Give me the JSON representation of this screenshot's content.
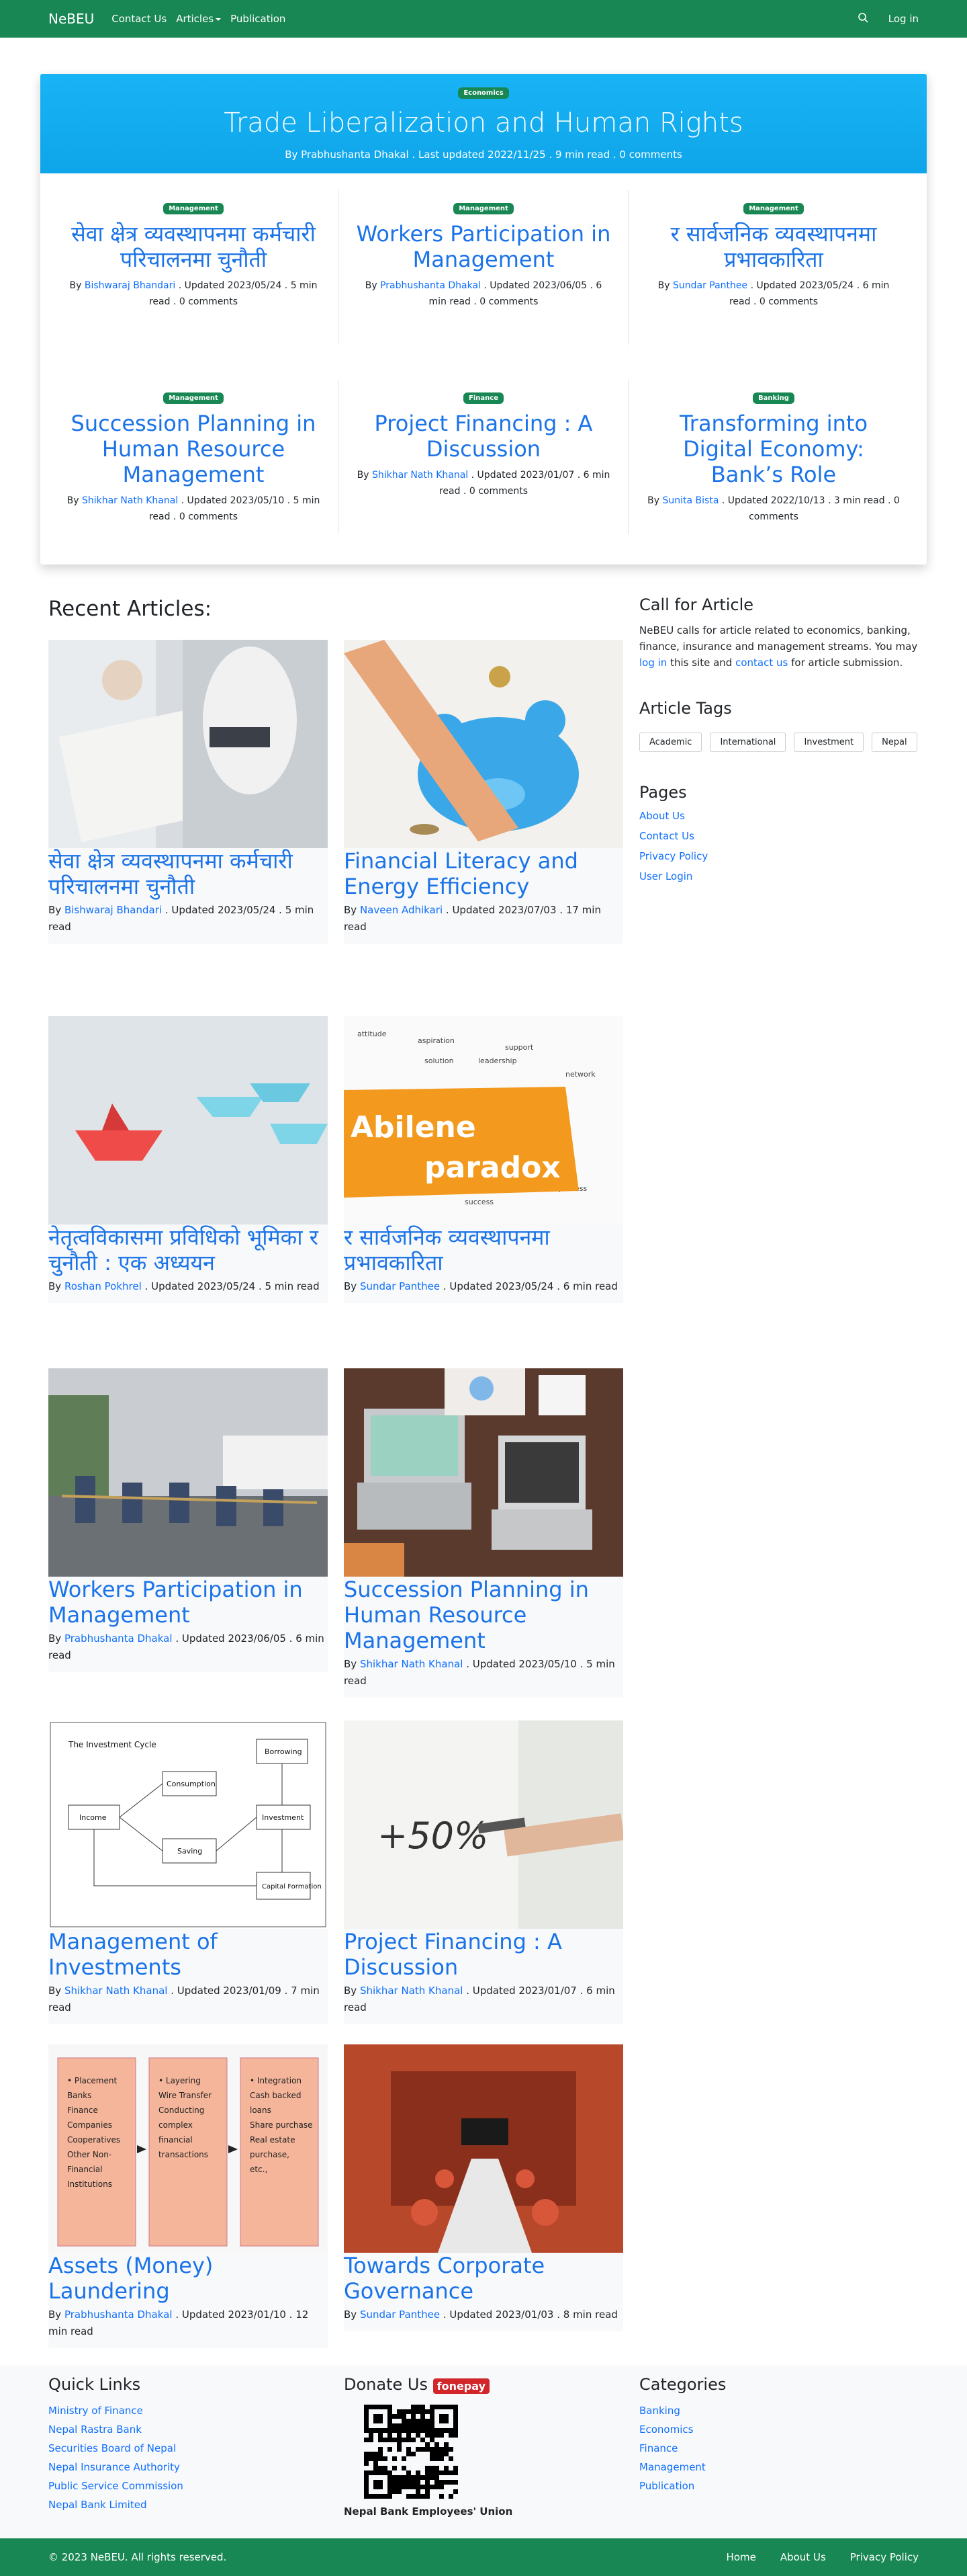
{
  "navbar": {
    "brand": "NeBEU",
    "links": [
      "Contact Us",
      "Articles",
      "Publication"
    ],
    "login": "Log in"
  },
  "hero": {
    "badge": "Economics",
    "title": "Trade Liberalization and Human Rights",
    "meta": "By Prabhushanta Dhakal . Last updated 2022/11/25 . 9 min read . 0 comments"
  },
  "featured": [
    {
      "badge": "Management",
      "title": "सेवा क्षेत्र व्यवस्थापनमा कर्मचारी परिचालनमा चुनौती",
      "author": "Bishwaraj Bhandari",
      "meta": ". Updated 2023/05/24 . 5 min read . 0 comments"
    },
    {
      "badge": "Management",
      "title": "Workers Participation in Management",
      "author": "Prabhushanta Dhakal",
      "meta": ". Updated 2023/06/05 . 6 min read . 0 comments"
    },
    {
      "badge": "Management",
      "title": "र सार्वजनिक व्यवस्थापनमा प्रभावकारिता",
      "author": "Sundar Panthee",
      "meta": ". Updated 2023/05/24 . 6 min read . 0 comments"
    },
    {
      "badge": "Management",
      "title": "Succession Planning in Human Resource Management",
      "author": "Shikhar Nath Khanal",
      "meta": ". Updated 2023/05/10 . 5 min read . 0 comments"
    },
    {
      "badge": "Finance",
      "title": "Project Financing : A Discussion",
      "author": "Shikhar Nath Khanal",
      "meta": ". Updated 2023/01/07 . 6 min read . 0 comments"
    },
    {
      "badge": "Banking",
      "title": "Transforming into Digital Economy: Bank’s Role",
      "author": "Sunita Bista",
      "meta": ". Updated 2022/10/13 . 3 min read . 0 comments"
    }
  ],
  "recent": {
    "heading": "Recent Articles:",
    "by": "By",
    "articles": [
      {
        "title": "सेवा क्षेत्र व्यवस्थापनमा कर्मचारी परिचालनमा चुनौती",
        "author": "Bishwaraj Bhandari",
        "meta": ". Updated 2023/05/24 . 5 min read",
        "img": "paperwork"
      },
      {
        "title": "Financial Literacy and Energy Efficiency",
        "author": "Naveen Adhikari",
        "meta": ". Updated 2023/07/03 . 17 min read",
        "img": "piggy-bank"
      },
      {
        "title": "नेतृत्वविकासमा प्रविधिको भूमिका र चुनौती : एक अध्ययन",
        "author": "Roshan Pokhrel",
        "meta": ". Updated 2023/05/24 . 5 min read",
        "img": "paper-boats"
      },
      {
        "title": "र सार्वजनिक व्यवस्थापनमा प्रभावकारिता",
        "author": "Sundar Panthee",
        "meta": ". Updated 2023/05/24 . 6 min read",
        "img": "abilene-paradox"
      },
      {
        "title": "Workers Participation in Management",
        "author": "Prabhushanta Dhakal",
        "meta": ". Updated 2023/06/05 . 6 min read",
        "img": "tug-of-war"
      },
      {
        "title": "Succession Planning in Human Resource Management",
        "author": "Shikhar Nath Khanal",
        "meta": ". Updated 2023/05/10 . 5 min read",
        "img": "laptops"
      },
      {
        "title": "Management of Investments",
        "author": "Shikhar Nath Khanal",
        "meta": ". Updated 2023/01/09 . 7 min read",
        "img": "investment-cycle"
      },
      {
        "title": "Project Financing : A Discussion",
        "author": "Shikhar Nath Khanal",
        "meta": ". Updated 2023/01/07 . 6 min read",
        "img": "whiteboard"
      },
      {
        "title": "Assets (Money) Laundering",
        "author": "Prabhushanta Dhakal",
        "meta": ". Updated 2023/01/10 . 12 min read",
        "img": "laundering-chart"
      },
      {
        "title": "Towards Corporate Governance",
        "author": "Sundar Panthee",
        "meta": ". Updated 2023/01/03 . 8 min read",
        "img": "meeting-room"
      }
    ]
  },
  "sidebar": {
    "call_title": "Call for Article",
    "call_text_1": "NeBEU calls for article related to economics, banking, finance, insurance and management streams. You may",
    "call_link_1": "log in",
    "call_text_2": "this site and",
    "call_link_2": "contact us",
    "call_text_3": "for article submission.",
    "tags_title": "Article Tags",
    "tags": [
      "Academic",
      "International",
      "Investment",
      "Nepal"
    ],
    "pages_title": "Pages",
    "pages": [
      "About Us",
      "Contact Us",
      "Privacy Policy",
      "User Login"
    ]
  },
  "diagram": {
    "title": "The Investment Cycle",
    "nodes": [
      "Borrowing",
      "Consumption",
      "Income",
      "Investment",
      "Saving",
      "Capital Formation"
    ]
  },
  "laundering": {
    "col1": [
      "Placement",
      "Banks",
      "Finance",
      "Companies",
      "Cooperatives",
      "Other Non-",
      "Financial",
      "Institutions"
    ],
    "col2": [
      "Layering",
      "Wire Transfer",
      "Conducting",
      "complex",
      "financial",
      "transactions"
    ],
    "col3": [
      "Integration",
      "Cash backed",
      "loans",
      "Share purchase",
      "Real estate",
      "purchase,",
      "etc.,"
    ]
  },
  "abilene": {
    "line1": "Abilene",
    "line2": "paradox"
  },
  "whiteboard": {
    "text": "+50%"
  },
  "footer": {
    "quick_title": "Quick Links",
    "quick": [
      "Ministry of Finance",
      "Nepal Rastra Bank",
      "Securities Board of Nepal",
      "Nepal Insurance Authority",
      "Public Service Commission",
      "Nepal Bank Limited"
    ],
    "donate": "Donate Us",
    "fonepay": "fonepay",
    "donate_caption": "Nepal Bank Employees' Union",
    "cat_title": "Categories",
    "cats": [
      "Banking",
      "Economics",
      "Finance",
      "Management",
      "Publication"
    ]
  },
  "bottom": {
    "copy": "© 2023 NeBEU. All rights reserved.",
    "links": [
      "Home",
      "About Us",
      "Privacy Policy"
    ]
  },
  "colors": {
    "green": "#198754",
    "blue": "#0ea5e9",
    "link": "#1a73e8"
  }
}
